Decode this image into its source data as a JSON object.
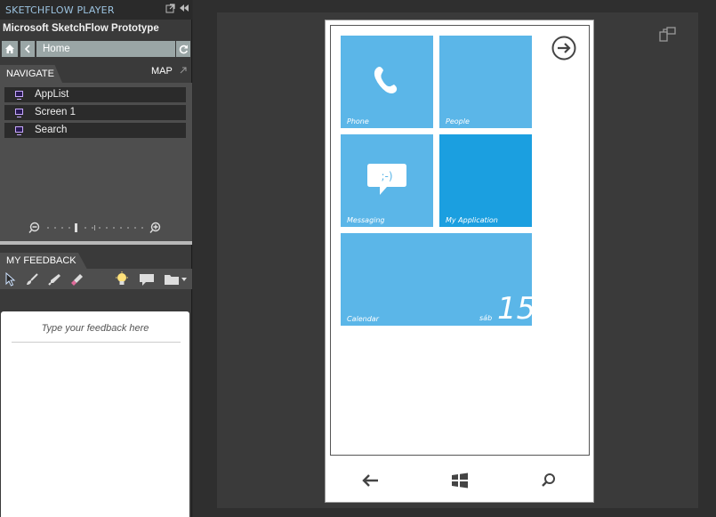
{
  "app": {
    "title": "SKETCHFLOW PLAYER",
    "project": "Microsoft SketchFlow Prototype"
  },
  "navbar": {
    "breadcrumb": "Home"
  },
  "navigate": {
    "tab_label": "NAVIGATE",
    "map_label": "MAP",
    "items": [
      {
        "label": "AppList"
      },
      {
        "label": "Screen 1"
      },
      {
        "label": "Search"
      }
    ]
  },
  "feedback": {
    "tab_label": "MY FEEDBACK",
    "placeholder": "Type your feedback here"
  },
  "tiles": [
    {
      "label": "Phone"
    },
    {
      "label": "People"
    },
    {
      "label": "Messaging"
    },
    {
      "label": "My Application"
    },
    {
      "label": "Calendar",
      "day": "sáb",
      "date": "15"
    }
  ],
  "colors": {
    "tile": "#5bb6e8",
    "tile_selected": "#1b9fe0",
    "screen_icon": "#c7a8ff"
  },
  "icons": {
    "messaging_glyph": ";-)"
  }
}
